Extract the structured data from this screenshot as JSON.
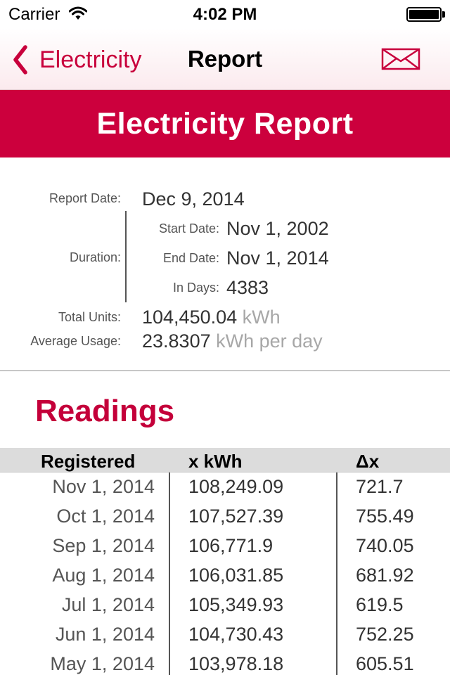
{
  "status_bar": {
    "carrier": "Carrier",
    "time": "4:02 PM"
  },
  "nav": {
    "back_label": "Electricity",
    "title": "Report",
    "mail_icon": "mail-icon"
  },
  "banner": {
    "title": "Electricity Report"
  },
  "summary": {
    "report_date_label": "Report Date:",
    "report_date": "Dec 9, 2014",
    "duration_label": "Duration:",
    "start_date_label": "Start Date:",
    "start_date": "Nov 1, 2002",
    "end_date_label": "End Date:",
    "end_date": "Nov 1, 2014",
    "in_days_label": "In Days:",
    "in_days": "4383",
    "total_units_label": "Total Units:",
    "total_units": "104,450.04",
    "total_units_unit": "kWh",
    "average_usage_label": "Average Usage:",
    "average_usage": "23.8307",
    "average_usage_unit": "kWh per day"
  },
  "readings": {
    "title": "Readings",
    "columns": [
      "Registered",
      "x kWh",
      "Δx"
    ],
    "rows": [
      {
        "date": "Nov 1, 2014",
        "kwh": "108,249.09",
        "delta": "721.7"
      },
      {
        "date": "Oct 1, 2014",
        "kwh": "107,527.39",
        "delta": "755.49"
      },
      {
        "date": "Sep 1, 2014",
        "kwh": "106,771.9",
        "delta": "740.05"
      },
      {
        "date": "Aug 1, 2014",
        "kwh": "106,031.85",
        "delta": "681.92"
      },
      {
        "date": "Jul 1, 2014",
        "kwh": "105,349.93",
        "delta": "619.5"
      },
      {
        "date": "Jun 1, 2014",
        "kwh": "104,730.43",
        "delta": "752.25"
      },
      {
        "date": "May 1, 2014",
        "kwh": "103,978.18",
        "delta": "605.51"
      }
    ]
  },
  "colors": {
    "accent": "#cc003d",
    "header_gray": "#dcdcdc",
    "unit_gray": "#a7a7a7"
  }
}
